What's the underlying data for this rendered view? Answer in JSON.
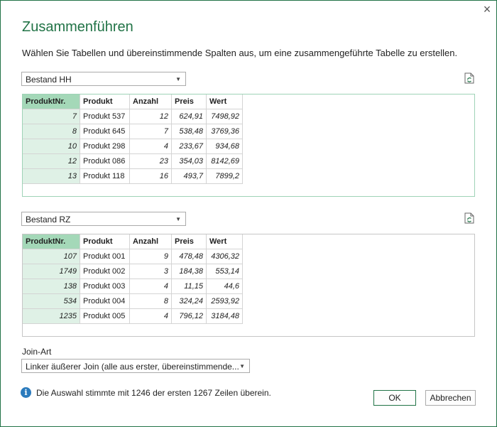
{
  "dialog": {
    "title": "Zusammenführen",
    "description": "Wählen Sie Tabellen und übereinstimmende Spalten aus, um eine zusammengeführte Tabelle zu erstellen.",
    "close_icon": "×"
  },
  "table1": {
    "select_value": "Bestand HH",
    "headers": [
      "ProduktNr.",
      "Produkt",
      "Anzahl",
      "Preis",
      "Wert"
    ],
    "rows": [
      [
        "7",
        "Produkt 537",
        "12",
        "624,91",
        "7498,92"
      ],
      [
        "8",
        "Produkt 645",
        "7",
        "538,48",
        "3769,36"
      ],
      [
        "10",
        "Produkt 298",
        "4",
        "233,67",
        "934,68"
      ],
      [
        "12",
        "Produkt 086",
        "23",
        "354,03",
        "8142,69"
      ],
      [
        "13",
        "Produkt 118",
        "16",
        "493,7",
        "7899,2"
      ]
    ]
  },
  "table2": {
    "select_value": "Bestand RZ",
    "headers": [
      "ProduktNr.",
      "Produkt",
      "Anzahl",
      "Preis",
      "Wert"
    ],
    "rows": [
      [
        "107",
        "Produkt 001",
        "9",
        "478,48",
        "4306,32"
      ],
      [
        "1749",
        "Produkt 002",
        "3",
        "184,38",
        "553,14"
      ],
      [
        "138",
        "Produkt 003",
        "4",
        "11,15",
        "44,6"
      ],
      [
        "534",
        "Produkt 004",
        "8",
        "324,24",
        "2593,92"
      ],
      [
        "1235",
        "Produkt 005",
        "4",
        "796,12",
        "3184,48"
      ]
    ]
  },
  "join": {
    "label": "Join-Art",
    "select_value": "Linker äußerer Join (alle aus erster, übereinstimmende..."
  },
  "status": {
    "icon": "i",
    "text": "Die Auswahl stimmte mit 1246 der ersten 1267 Zeilen überein."
  },
  "buttons": {
    "ok": "OK",
    "cancel": "Abbrechen"
  },
  "colors": {
    "accent": "#217346",
    "key_header": "#a4d8b8",
    "key_cell": "#dff1e6",
    "info": "#2b7bbd"
  }
}
